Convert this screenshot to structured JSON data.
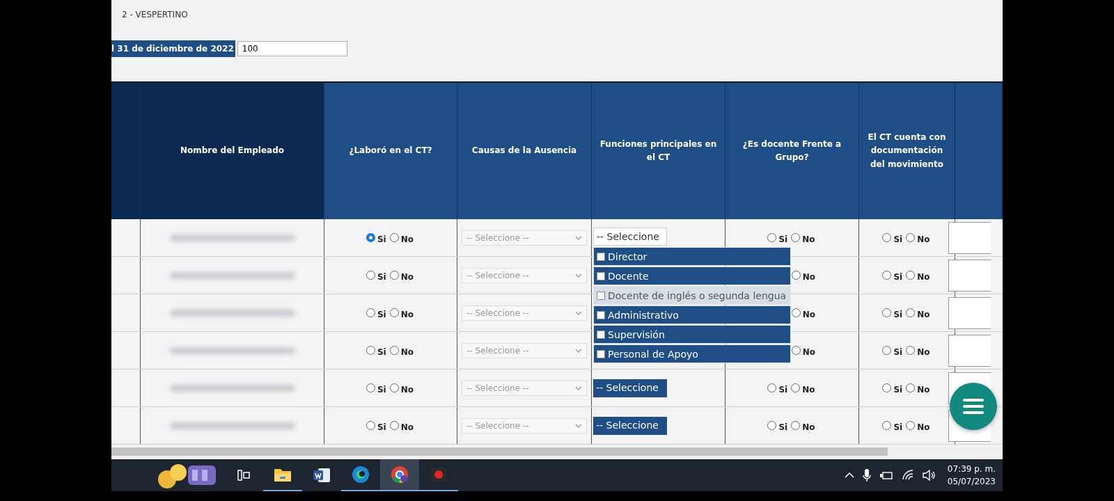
{
  "header": {
    "shift": "2 - VESPERTINO",
    "count_label": "l 31 de diciembre de 2022",
    "count_value": "100"
  },
  "table": {
    "columns": [
      "",
      "Nombre del Empleado",
      "¿Laboró en el CT?",
      "Causas de la Ausencia",
      "Funciones principales en el CT",
      "¿Es docente Frente a Grupo?",
      "El CT cuenta con documentación del movimiento",
      ""
    ],
    "rows": [
      {
        "worked": [
          {
            "label": "Si",
            "selected": true
          },
          {
            "label": "No",
            "selected": false
          }
        ],
        "cause": "-- Seleccione --",
        "function": {
          "label": "-- Seleccione",
          "open": true
        },
        "teacher": [
          {
            "label": "Si",
            "selected": false
          },
          {
            "label": "No",
            "selected": false
          }
        ],
        "docs": [
          {
            "label": "Si",
            "selected": false
          },
          {
            "label": "No",
            "selected": false
          }
        ]
      },
      {
        "worked": [
          {
            "label": "Si",
            "selected": false
          },
          {
            "label": "No",
            "selected": false
          }
        ],
        "cause": "-- Seleccione --",
        "teacher": [
          {
            "label": "No",
            "selected": false
          }
        ],
        "docs": [
          {
            "label": "Si",
            "selected": false
          },
          {
            "label": "No",
            "selected": false
          }
        ]
      },
      {
        "worked": [
          {
            "label": "Si",
            "selected": false
          },
          {
            "label": "No",
            "selected": false
          }
        ],
        "cause": "-- Seleccione --",
        "teacher": [
          {
            "label": "No",
            "selected": false
          }
        ],
        "docs": [
          {
            "label": "Si",
            "selected": false
          },
          {
            "label": "No",
            "selected": false
          }
        ]
      },
      {
        "worked": [
          {
            "label": "Si",
            "selected": false
          },
          {
            "label": "No",
            "selected": false
          }
        ],
        "cause": "-- Seleccione --",
        "teacher": [
          {
            "label": "No",
            "selected": false
          }
        ],
        "docs": [
          {
            "label": "Si",
            "selected": false
          },
          {
            "label": "No",
            "selected": false
          }
        ]
      },
      {
        "worked": [
          {
            "label": "Si",
            "selected": false
          },
          {
            "label": "No",
            "selected": false
          }
        ],
        "cause": "-- Seleccione --",
        "function": {
          "label": "-- Seleccione",
          "open": false
        },
        "teacher": [
          {
            "label": "Si",
            "selected": false
          },
          {
            "label": "No",
            "selected": false
          }
        ],
        "docs": [
          {
            "label": "Si",
            "selected": false
          },
          {
            "label": "No",
            "selected": false
          }
        ]
      },
      {
        "worked": [
          {
            "label": "Si",
            "selected": false
          },
          {
            "label": "No",
            "selected": false
          }
        ],
        "cause": "-- Seleccione --",
        "function": {
          "label": "-- Seleccione",
          "open": false
        },
        "teacher": [
          {
            "label": "Si",
            "selected": false
          },
          {
            "label": "No",
            "selected": false
          }
        ],
        "docs": [
          {
            "label": "Si",
            "selected": false
          },
          {
            "label": "No",
            "selected": false
          }
        ]
      }
    ]
  },
  "function_options": [
    {
      "label": "Director",
      "checked": false,
      "highlighted": false
    },
    {
      "label": "Docente",
      "checked": false,
      "highlighted": false
    },
    {
      "label": "Docente de inglés o segunda lengua",
      "checked": false,
      "highlighted": true
    },
    {
      "label": "Administrativo",
      "checked": false,
      "highlighted": false
    },
    {
      "label": "Supervisión",
      "checked": false,
      "highlighted": false
    },
    {
      "label": "Personal de Apoyo",
      "checked": false,
      "highlighted": false
    }
  ],
  "taskbar": {
    "time": "07:39 p. m.",
    "date": "05/07/2023"
  }
}
